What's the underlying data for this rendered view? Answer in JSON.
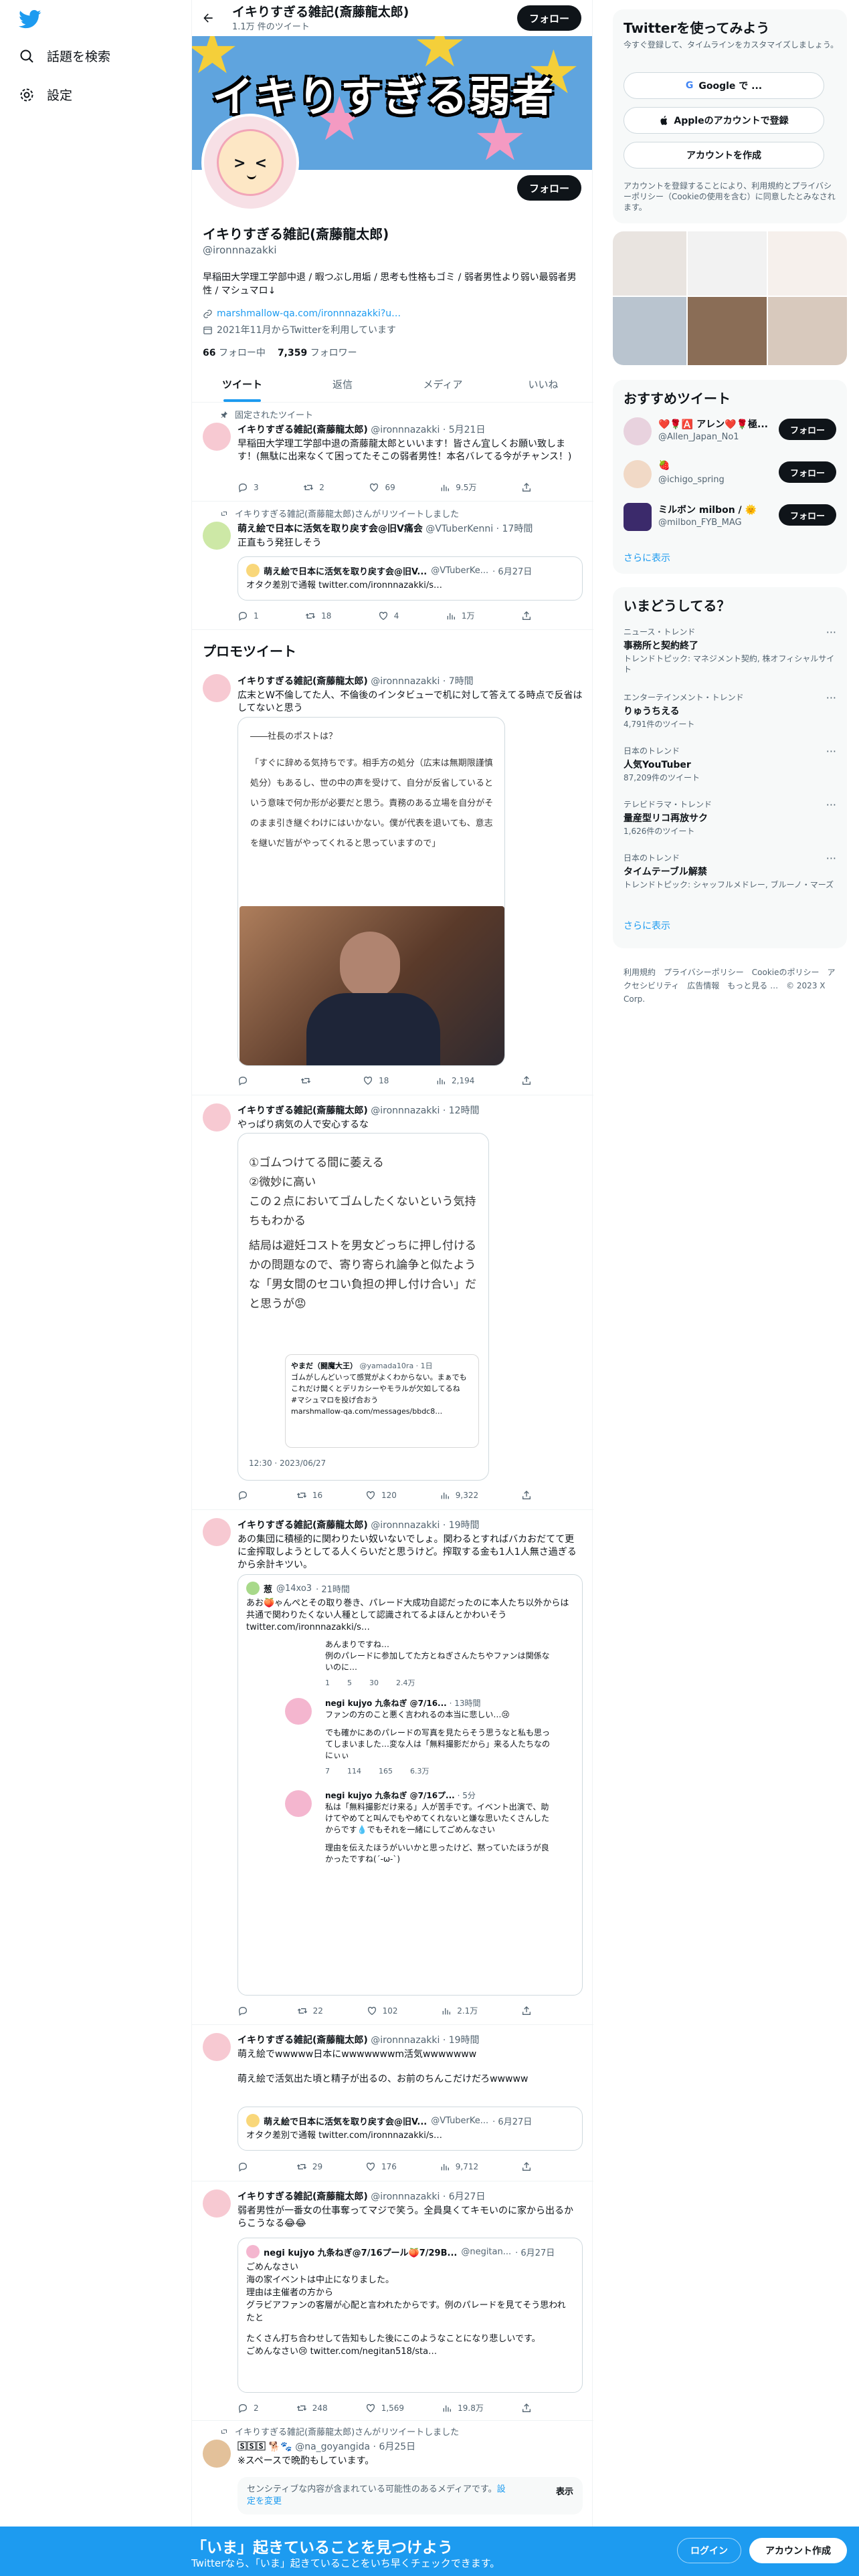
{
  "nav": {
    "explore": "話題を検索",
    "settings": "設定"
  },
  "header": {
    "name": "イキりすぎる雑記(斎藤龍太郎)",
    "count": "1.1万 件のツイート",
    "follow": "フォロー"
  },
  "banner": {
    "text": "イキりすぎる弱者"
  },
  "profile": {
    "name": "イキりすぎる雑記(斎藤龍太郎)",
    "handle": "@ironnnazakki",
    "bio": "早稲田大学理工学部中退 / 暇つぶし用垢 / 思考も性格もゴミ / 弱者男性より弱い最弱者男性 / マシュマロ↓",
    "link": "marshmallow-qa.com/ironnnazakki?u…",
    "joined": "2021年11月からTwitterを利用しています",
    "following_num": "66",
    "following_label": "フォロー中",
    "followers_num": "7,359",
    "followers_label": "フォロワー",
    "follow": "フォロー"
  },
  "tabs": [
    "ツイート",
    "返信",
    "メディア",
    "いいね"
  ],
  "tweets": {
    "t1": {
      "context": "固定されたツイート",
      "name": "イキりすぎる雑記(斎藤龍太郎)",
      "handle": "@ironnnazakki",
      "time": "· 5月21日",
      "text": "早稲田大学理工学部中退の斎藤龍太郎といいます！皆さん宜しくお願い致します！(無駄に出来なくて困ってたそこの弱者男性！本名バレてる今がチャンス！)",
      "replies": "3",
      "retweets": "2",
      "likes": "69",
      "views": "9.5万"
    },
    "t2": {
      "context": "イキりすぎる雑記(斎藤龍太郎)さんがリツイートしました",
      "name": "萌え絵で日本に活気を取り戻す会@旧V痛会",
      "handle": "@VTuberKenni",
      "time": "· 17時間",
      "text": "正直もう発狂しそう",
      "q_name": "萌え絵で日本に活気を取り戻す会@旧V...",
      "q_handle": "@VTuberKe...",
      "q_time": "· 6月27日",
      "q_text": "オタク差別で通報 twitter.com/ironnnazakki/s…",
      "replies": "1",
      "retweets": "18",
      "likes": "4",
      "views": "1万"
    },
    "promo_title": "プロモツイート",
    "t3": {
      "name": "イキりすぎる雑記(斎藤龍太郎)",
      "handle": "@ironnnazakki",
      "time": "· 7時間",
      "text": "広末とW不倫してた人、不倫後のインタビューで机に対して答えてる時点で反省はしてないと思う",
      "img_title": "――社長のポストは？",
      "img_text": "「すぐに辞める気持ちです。相手方の処分（広末は無期限謹慎処分）もあるし、世の中の声を受けて、自分が反省しているという意味で何か形が必要だと思う。責務のある立場を自分がそのまま引き継ぐわけにはいかない。僕が代表を退いても、意志を継いだ皆がやってくれると思っていますので」",
      "replies": "",
      "retweets": "",
      "likes": "18",
      "views": "2,194"
    },
    "t4": {
      "name": "イキりすぎる雑記(斎藤龍太郎)",
      "handle": "@ironnnazakki",
      "time": "· 12時間",
      "text": "やっぱり病気の人で安心するな",
      "img_lines": [
        "①ゴムつけてる間に萎える",
        "②微妙に高い",
        "この２点においてゴムしたくないという気持ちもわかる",
        "結局は避妊コストを男女どっちに押し付けるかの問題なので、寄り寄られ論争と似たような「男女間のセコい負担の押し付け合い」だと思うが😡"
      ],
      "img_q_name": "やまだ（闘魔大王）",
      "img_q_handle": "@yamada10ra · 1日",
      "img_q_text": "ゴムがしんどいって感覚がよくわからない。まぁでもこれだけ聞くとデリカシーやモラルが欠如してるね",
      "img_q_tag": "#マシュマロを投げ合おう",
      "img_q_link": "marshmallow-qa.com/messages/bbdc8…",
      "img_time": "12:30 · 2023/06/27",
      "replies": "",
      "retweets": "16",
      "likes": "120",
      "views": "9,322"
    },
    "t5": {
      "name": "イキりすぎる雑記(斎藤龍太郎)",
      "handle": "@ironnnazakki",
      "time": "· 19時間",
      "text": "あの集団に積極的に関わりたい奴いないでしょ。関わるとすればバカおだてて更に金搾取しようとしてる人くらいだと思うけど。搾取する金も1人1人無さ過ぎるから余計キツい。",
      "q_name": "葱",
      "q_handle": "@14xo3",
      "q_time": "· 21時間",
      "q_text": "あお🍑ゃんぺとその取り巻き、パレード大成功自認だったのに本人たち以外からは共通で関わりたくない人種として認識されてるよほんとかわいそう twitter.com/ironnnazakki/s…",
      "sub1_text": "あんまりですね…",
      "sub1_text2": "例のパレードに参加してた方とねぎさんたちやファンは関係ないのに…",
      "sub1_counts": [
        "1",
        "5",
        "30",
        "2.4万"
      ],
      "sub2_name": "negi kujyo 九条ねぎ @7/16...",
      "sub2_time": "· 13時間",
      "sub2_text": "ファンの方のこと悪く言われるの本当に悲しい…😢",
      "sub2_text2": "でも確かにあのパレードの写真を見たらそう思うなと私も思ってしまいました…変な人は「無料撮影だから」来る人たちなのにぃぃ",
      "sub2_counts": [
        "7",
        "114",
        "165",
        "6.3万"
      ],
      "sub3_name": "negi kujyo 九条ねぎ @7/16プ...",
      "sub3_time": "· 5分",
      "sub3_text": "私は「無料撮影だけ来る」人が苦手です。イベント出演で、助けてやめてと叫んでもやめてくれないと嫌な思いたくさんしたからです💧でもそれを一緒にしてごめんなさい",
      "sub3_text2": "理由を伝えたほうがいいかと思ったけど、黙っていたほうが良かったですね(´-ω-`)",
      "replies": "",
      "retweets": "22",
      "likes": "102",
      "views": "2.1万"
    },
    "t6": {
      "name": "イキりすぎる雑記(斎藤龍太郎)",
      "handle": "@ironnnazakki",
      "time": "· 19時間",
      "text": "萌え絵でwwwww日本にwwwwwwwm活気wwwwwww",
      "text2": "萌え絵で活気出た頃と精子が出るの、お前のちんこだけだろwwwww",
      "q_name": "萌え絵で日本に活気を取り戻す会@旧V...",
      "q_handle": "@VTuberKe...",
      "q_time": "· 6月27日",
      "q_text": "オタク差別で通報 twitter.com/ironnnazakki/s…",
      "replies": "",
      "retweets": "29",
      "likes": "176",
      "views": "9,712"
    },
    "t7": {
      "name": "イキりすぎる雑記(斎藤龍太郎)",
      "handle": "@ironnnazakki",
      "time": "· 6月27日",
      "text": "弱者男性が一番女の仕事奪ってマジで笑う。全員臭くてキモいのに家から出るからこうなる😂😂",
      "q_name": "negi kujyo 九条ねぎ@7/16プール🍑7/29B...",
      "q_handle": "@negitan...",
      "q_time": "· 6月27日",
      "q_lines": [
        "ごめんなさい",
        "海の家イベントは中止になりました。",
        "理由は主催者の方から",
        "グラビアファンの客層が心配と言われたからです。例のパレードを見てそう思われたと",
        "",
        "たくさん打ち合わせして告知もした後にこのようなことになり悲しいです。",
        "ごめんなさい😢 twitter.com/negitan518/sta…"
      ],
      "replies": "2",
      "retweets": "248",
      "likes": "1,569",
      "views": "19.8万"
    },
    "t8": {
      "context": "イキりすぎる雑記(斎藤龍太郎)さんがリツイートしました",
      "name": "🅂🅂🅂 🐕🐾",
      "handle": "@na_goyangida",
      "time": "· 6月25日",
      "text": "※スペースで晩酌もしています。",
      "sensitive": "センシティブな内容が含まれている可能性のあるメディアです。",
      "sensitive_link": "設定を変更",
      "show": "表示"
    }
  },
  "sidebar": {
    "join_title": "Twitterを使ってみよう",
    "join_sub": "今すぐ登録して、タイムラインをカスタマイズしましょう。",
    "google": "Google で ...",
    "apple": "Appleのアカウントで登録",
    "create": "アカウントを作成",
    "terms": "アカウントを登録することにより、利用規約とプライバシーポリシー（Cookieの使用を含む）に同意したとみなされます。",
    "rec_title": "おすすめツイート",
    "rec": [
      {
        "name": "❤️🌹🅰️ アレン❤️🌹極...",
        "handle": "@Allen_Japan_No1",
        "btn": "フォロー"
      },
      {
        "name": "🍓",
        "handle": "@ichigo_spring",
        "btn": "フォロー"
      },
      {
        "name": "ミルボン milbon / 🌞",
        "handle": "@milbon_FYB_MAG",
        "btn": "フォロー"
      }
    ],
    "more": "さらに表示",
    "trends_title": "いまどうしてる？",
    "trends": [
      {
        "cat": "ニュース・トレンド",
        "name": "事務所と契約終了",
        "extra": "トレンドトピック: マネジメント契約, 株オフィシャルサイト"
      },
      {
        "cat": "エンターテインメント・トレンド",
        "name": "りゅうちえる",
        "extra": "4,791件のツイート"
      },
      {
        "cat": "日本のトレンド",
        "name": "人気YouTuber",
        "extra": "87,209件のツイート"
      },
      {
        "cat": "テレビドラマ・トレンド",
        "name": "量産型リコ再放サク",
        "extra": "1,626件のツイート"
      },
      {
        "cat": "日本のトレンド",
        "name": "タイムテーブル解禁",
        "extra": "トレンドトピック: シャッフルメドレー, ブルーノ・マーズ"
      }
    ],
    "trends_more": "さらに表示",
    "footer": "利用規約　プライバシーポリシー　Cookieのポリシー　アクセシビリティ　広告情報　もっと見る …　© 2023 X Corp."
  },
  "bottom": {
    "title": "「いま」起きていることを見つけよう",
    "sub": "Twitterなら、「いま」起きていることをいち早くチェックできます。",
    "login": "ログイン",
    "signup": "アカウント作成"
  },
  "colors": {
    "accent": "#1d9bf0",
    "dark": "#0f1419",
    "muted": "#536471"
  }
}
